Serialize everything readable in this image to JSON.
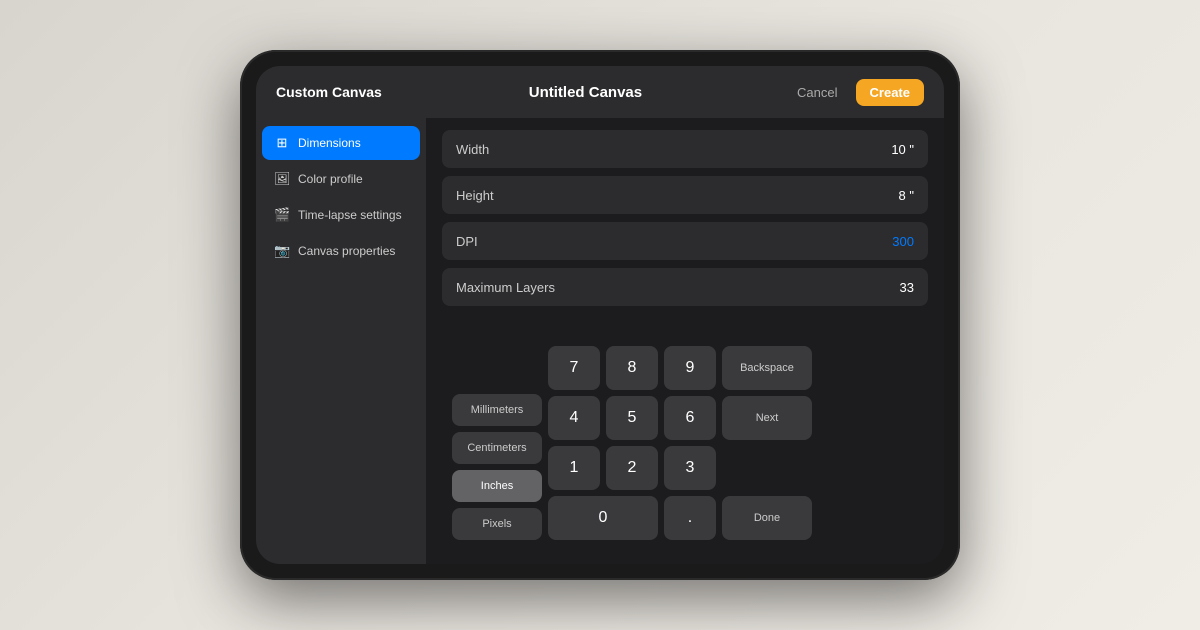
{
  "app": {
    "title": "Custom Canvas",
    "canvas_name": "Untitled Canvas",
    "cancel_label": "Cancel",
    "create_label": "Create"
  },
  "sidebar": {
    "items": [
      {
        "id": "dimensions",
        "label": "Dimensions",
        "icon": "⊞",
        "active": true
      },
      {
        "id": "color-profile",
        "label": "Color profile",
        "icon": "🖼",
        "active": false
      },
      {
        "id": "timelapse",
        "label": "Time-lapse settings",
        "icon": "🎬",
        "active": false
      },
      {
        "id": "canvas-properties",
        "label": "Canvas properties",
        "icon": "📷",
        "active": false
      }
    ]
  },
  "fields": {
    "width": {
      "label": "Width",
      "value": "10 \""
    },
    "height": {
      "label": "Height",
      "value": "8 \""
    },
    "dpi": {
      "label": "DPI",
      "value": "300",
      "active": true
    },
    "max_layers": {
      "label": "Maximum Layers",
      "value": "33"
    }
  },
  "numpad": {
    "units": [
      {
        "id": "millimeters",
        "label": "Millimeters",
        "active": false
      },
      {
        "id": "centimeters",
        "label": "Centimeters",
        "active": false
      },
      {
        "id": "inches",
        "label": "Inches",
        "active": true
      },
      {
        "id": "pixels",
        "label": "Pixels",
        "active": false
      }
    ],
    "digits": [
      "7",
      "8",
      "9",
      "4",
      "5",
      "6",
      "1",
      "2",
      "3",
      "0",
      "."
    ],
    "actions": {
      "backspace": "Backspace",
      "next": "Next",
      "done": "Done"
    }
  }
}
